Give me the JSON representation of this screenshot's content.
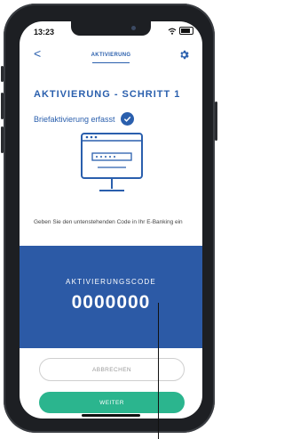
{
  "status_bar": {
    "time": "13:23"
  },
  "nav": {
    "back_symbol": "<",
    "title": "AKTIVIERUNG",
    "settings_icon": "gear-icon"
  },
  "page": {
    "heading": "AKTIVIERUNG - SCHRITT 1",
    "letter_status": "Briefaktivierung erfasst",
    "instruction": "Geben Sie den untenstehenden Code in Ihr E-Banking ein"
  },
  "code_panel": {
    "label": "AKTIVIERUNGSCODE",
    "code": "0000000"
  },
  "buttons": {
    "cancel": "ABBRECHEN",
    "next": "WEITER"
  },
  "colors": {
    "brand_blue": "#2a5fad",
    "panel_blue": "#2c5aa6",
    "accent_green": "#2bb58e"
  }
}
